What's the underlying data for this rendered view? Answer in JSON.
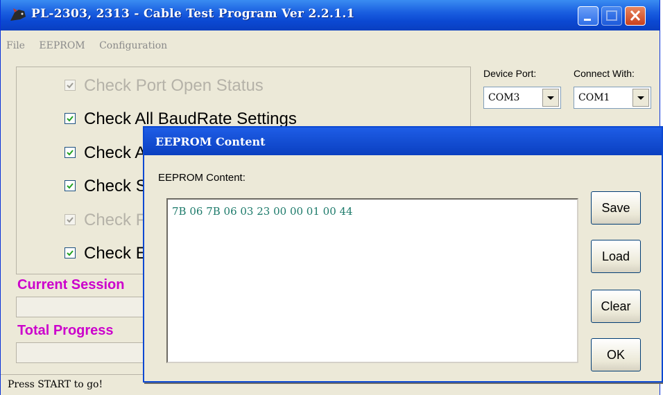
{
  "window": {
    "title": "PL-2303, 2313 - Cable Test Program Ver 2.2.1.1"
  },
  "menu": [
    "File",
    "EEPROM",
    "Configuration"
  ],
  "checks": [
    {
      "label": "Check Port Open Status",
      "checked": true,
      "enabled": false
    },
    {
      "label": "Check All BaudRate Settings",
      "checked": true,
      "enabled": true
    },
    {
      "label": "Check A",
      "checked": true,
      "enabled": true
    },
    {
      "label": "Check S",
      "checked": true,
      "enabled": true
    },
    {
      "label": "Check F",
      "checked": true,
      "enabled": false
    },
    {
      "label": "Check E",
      "checked": true,
      "enabled": true
    }
  ],
  "ports": {
    "device_label": "Device Port:",
    "device_value": "COM3",
    "connect_label": "Connect With:",
    "connect_value": "COM1"
  },
  "progress": {
    "current_label": "Current Session",
    "total_label": "Total Progress",
    "current_value": 0,
    "total_value": 0
  },
  "status": "Press START to go!",
  "dialog": {
    "title": "EEPROM Content",
    "field_label": "EEPROM Content:",
    "content": "7B 06 7B 06 03 23 00 00 01 00 44",
    "buttons": [
      "Save",
      "Load",
      "Clear",
      "OK"
    ]
  },
  "colors": {
    "title_bar": "#0b48d2",
    "section_label": "#cc00cc",
    "content_text": "#1c7a6a",
    "window_bg": "#ece9d8"
  }
}
